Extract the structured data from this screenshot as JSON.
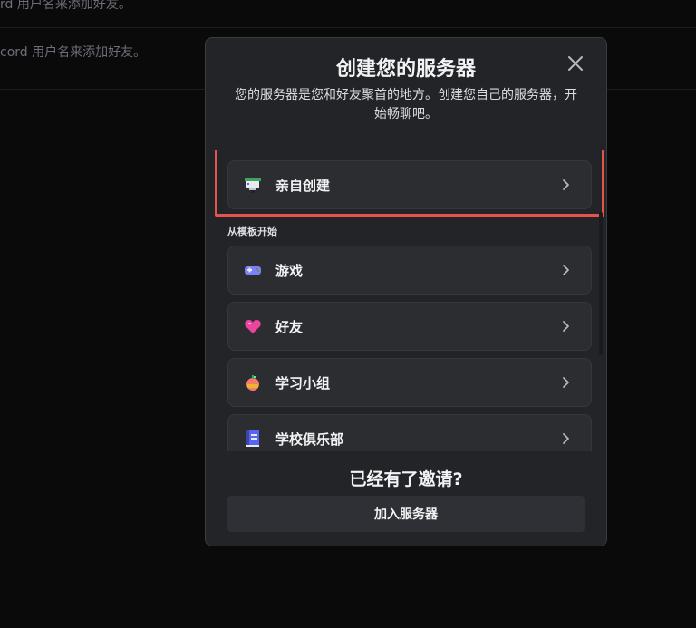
{
  "background": {
    "line1": "rd 用户名来添加好友。",
    "line2": "cord 用户名来添加好友。"
  },
  "modal": {
    "title": "创建您的服务器",
    "subtitle": "您的服务器是您和好友聚首的地方。创建您自己的服务器，开始畅聊吧。",
    "close_icon": "close-icon",
    "create_own": {
      "label": "亲自创建",
      "icon": "create-own-icon"
    },
    "templates_label": "从模板开始",
    "templates": [
      {
        "label": "游戏",
        "icon": "gamepad-icon"
      },
      {
        "label": "好友",
        "icon": "heart-icon"
      },
      {
        "label": "学习小组",
        "icon": "apple-icon"
      },
      {
        "label": "学校俱乐部",
        "icon": "book-icon"
      }
    ],
    "footer_title": "已经有了邀请?",
    "join_button": "加入服务器"
  },
  "colors": {
    "modal_bg": "#232428",
    "option_bg": "#2b2d31",
    "highlight": "#e5534b",
    "text": "#f2f3f5"
  }
}
